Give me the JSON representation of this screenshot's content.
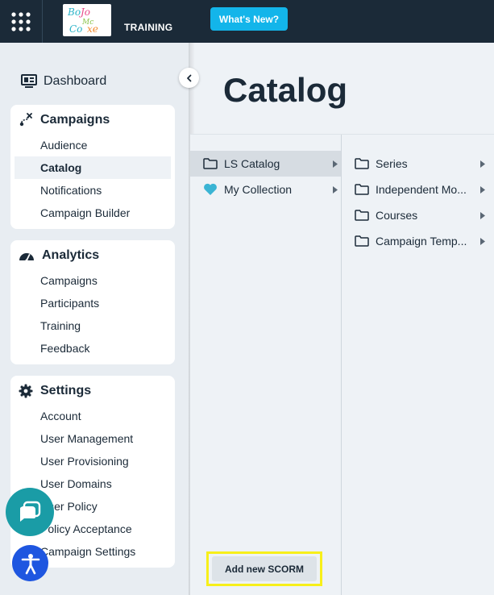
{
  "topbar": {
    "logo_text": "BoJo Mc Coxe",
    "training_label": "TRAINING",
    "whats_new_label": "What's New?"
  },
  "sidebar": {
    "dashboard_label": "Dashboard",
    "sections": [
      {
        "title": "Campaigns",
        "icon": "campaign-route-icon",
        "items": [
          {
            "label": "Audience",
            "active": false
          },
          {
            "label": "Catalog",
            "active": true
          },
          {
            "label": "Notifications",
            "active": false
          },
          {
            "label": "Campaign Builder",
            "active": false
          }
        ]
      },
      {
        "title": "Analytics",
        "icon": "gauge-icon",
        "items": [
          {
            "label": "Campaigns"
          },
          {
            "label": "Participants"
          },
          {
            "label": "Training"
          },
          {
            "label": "Feedback"
          }
        ]
      },
      {
        "title": "Settings",
        "icon": "gear-icon",
        "items": [
          {
            "label": "Account"
          },
          {
            "label": "User Management"
          },
          {
            "label": "User Provisioning"
          },
          {
            "label": "User Domains"
          },
          {
            "label": "User Policy"
          },
          {
            "label": "Policy Acceptance"
          },
          {
            "label": "Campaign Settings"
          }
        ]
      }
    ]
  },
  "main": {
    "title": "Catalog",
    "column1": [
      {
        "label": "LS Catalog",
        "icon": "folder-icon",
        "selected": true
      },
      {
        "label": "My Collection",
        "icon": "heart-icon",
        "selected": false
      }
    ],
    "column2": [
      {
        "label": "Series",
        "icon": "folder-icon"
      },
      {
        "label": "Independent Mo...",
        "icon": "folder-icon"
      },
      {
        "label": "Courses",
        "icon": "folder-icon"
      },
      {
        "label": "Campaign Temp...",
        "icon": "folder-icon"
      }
    ],
    "add_scorm_label": "Add new SCORM"
  },
  "colors": {
    "topbar": "#1b2a38",
    "accent": "#13b5ea",
    "heart": "#3ab4d4",
    "chat": "#1a9ca6",
    "accessibility": "#1e56e0",
    "highlight": "#f7ef1a"
  }
}
